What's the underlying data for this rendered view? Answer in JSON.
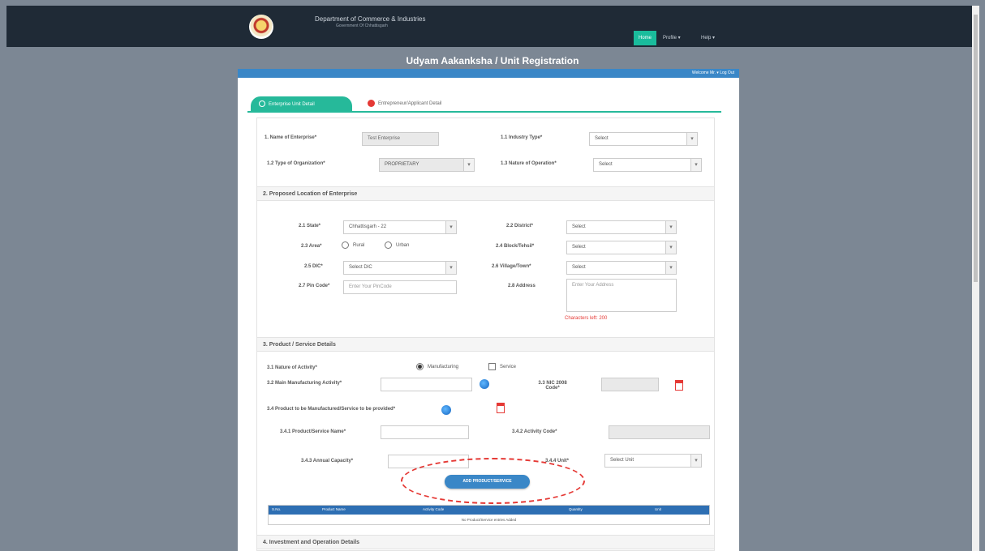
{
  "header": {
    "department": "Department of Commerce & Industries",
    "government": "Government Of Chhattisgarh",
    "nav": [
      "Home",
      "Profile ▾",
      "Help ▾"
    ]
  },
  "page_title": "Udyam Aakanksha / Unit Registration",
  "welcome": "Welcome Mr. ▾  Log Out",
  "tabs": {
    "active": "Enterprise Unit Detail",
    "inactive": "Entrepreneur/Applicant Detail"
  },
  "form": {
    "name_label": "1. Name of Enterprise*",
    "name_value": "Test Enterprise",
    "industry_label": "1.1 Industry Type*",
    "industry_value": "Select",
    "org_label": "1.2 Type of Organization*",
    "org_value": "PROPRIETARY",
    "operation_label": "1.3 Nature of Operation*",
    "operation_value": "Select",
    "sec2": "2. Proposed Location of Enterprise",
    "state_label": "2.1 State*",
    "state_value": "Chhattisgarh - 22",
    "district_label": "2.2 District*",
    "district_value": "Select",
    "area_label": "2.3 Area*",
    "area_opts": [
      "Rural",
      "Urban"
    ],
    "block_label": "2.4 Block/Tehsil*",
    "block_value": "Select",
    "dic_label": "2.5 DIC*",
    "dic_value": "Select DIC",
    "nagar_label": "2.6 Village/Town*",
    "nagar_value": "Select",
    "pin_label": "2.7 Pin Code*",
    "pin_placeholder": "Enter Your PinCode",
    "address_label": "2.8 Address",
    "address_placeholder": "Enter Your Address",
    "chars_left": "Characters left: 200",
    "sec3": "3. Product / Service Details",
    "activity_label": "3.1 Nature of Activity*",
    "activity_opts": [
      "Manufacturing",
      "Service"
    ],
    "main_label": "3.2 Main Manufacturing Activity*",
    "nic_label": "3.3 NIC 2008 Code*",
    "product_label": "3.4 Product to be Manufactured/Service to be provided*",
    "pname_label": "3.4.1 Product/Service Name*",
    "acode_label": "3.4.2 Activity Code*",
    "capacity_label": "3.4.3 Annual Capacity*",
    "unit_label": "3.4.4 Unit*",
    "unit_value": "Select Unit",
    "add_button": "ADD PRODUCT/SERVICE",
    "table_headers": [
      "S.No.",
      "Product Name",
      "Activity Code",
      "Quantity",
      "Unit"
    ],
    "table_empty": "No Product/Service entries Added",
    "sec4": "4. Investment and Operation Details"
  }
}
